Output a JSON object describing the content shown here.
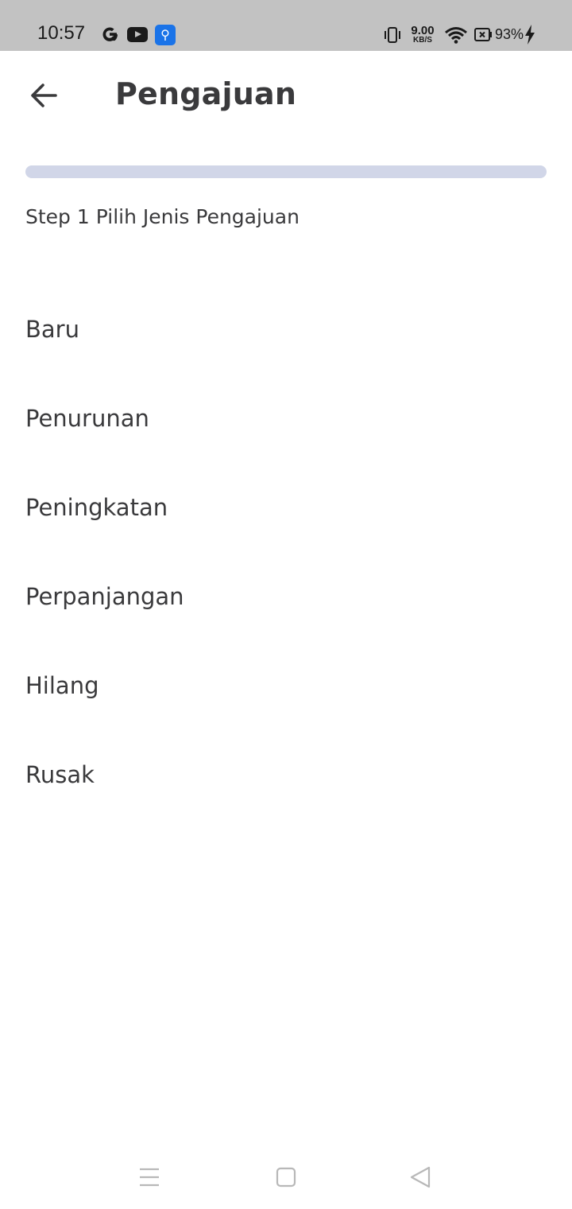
{
  "status_bar": {
    "time": "10:57",
    "net_speed_value": "9.00",
    "net_speed_unit": "KB/S",
    "battery_percent": "93%",
    "icons": [
      "google-icon",
      "youtube-icon",
      "usb-icon",
      "vibrate-icon",
      "wifi-icon",
      "battery-icon",
      "charging-icon"
    ]
  },
  "app_bar": {
    "title": "Pengajuan",
    "back_icon": "arrow-left-icon"
  },
  "progress": {
    "value": 0,
    "track_color": "#d1d6e8"
  },
  "step": {
    "label": "Step 1 Pilih Jenis Pengajuan"
  },
  "options": [
    {
      "label": "Baru"
    },
    {
      "label": "Penurunan"
    },
    {
      "label": "Peningkatan"
    },
    {
      "label": "Perpanjangan"
    },
    {
      "label": "Hilang"
    },
    {
      "label": "Rusak"
    }
  ],
  "nav_bar": {
    "icons": [
      "menu-icon",
      "home-icon",
      "back-triangle-icon"
    ]
  }
}
